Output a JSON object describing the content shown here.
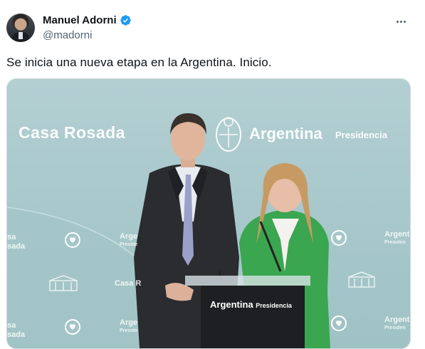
{
  "author": {
    "display_name": "Manuel Adorni",
    "handle": "@madorni",
    "verified": true,
    "avatar_icon": "profile-photo"
  },
  "menu_icon": "more-options-icon",
  "tweet": {
    "text": "Se inicia una nueva etapa en la Argentina. Inicio."
  },
  "photo": {
    "backdrop_left_title": "Casa Rosada",
    "backdrop_right_title": "Argentina",
    "backdrop_right_subtitle": "Presidencia",
    "repeat_casa_left_1": "sa",
    "repeat_casa_left_2": "sada",
    "repeat_casa_left_3": "sa",
    "repeat_casa_left_4": "sada",
    "repeat_casa_mid": "Casa R",
    "repeat_argen_mid": "Arge",
    "repeat_pres_mid": "Preside",
    "repeat_argen_mid2": "Arge",
    "repeat_pres_mid2": "Preside",
    "repeat_argen_right_1": "Argent",
    "repeat_pres_right_1": "Presiden",
    "repeat_argen_right_2": "Argent",
    "repeat_pres_right_2": "Presiden",
    "podium_title": "Argentina",
    "podium_subtitle": "Presidencia",
    "colors": {
      "backdrop": "#a8c8cb",
      "jacket_green": "#3aa64f",
      "suit_dark": "#2a2c30",
      "podium": "#1e1f22",
      "verified_blue": "#1d9bf0"
    }
  }
}
